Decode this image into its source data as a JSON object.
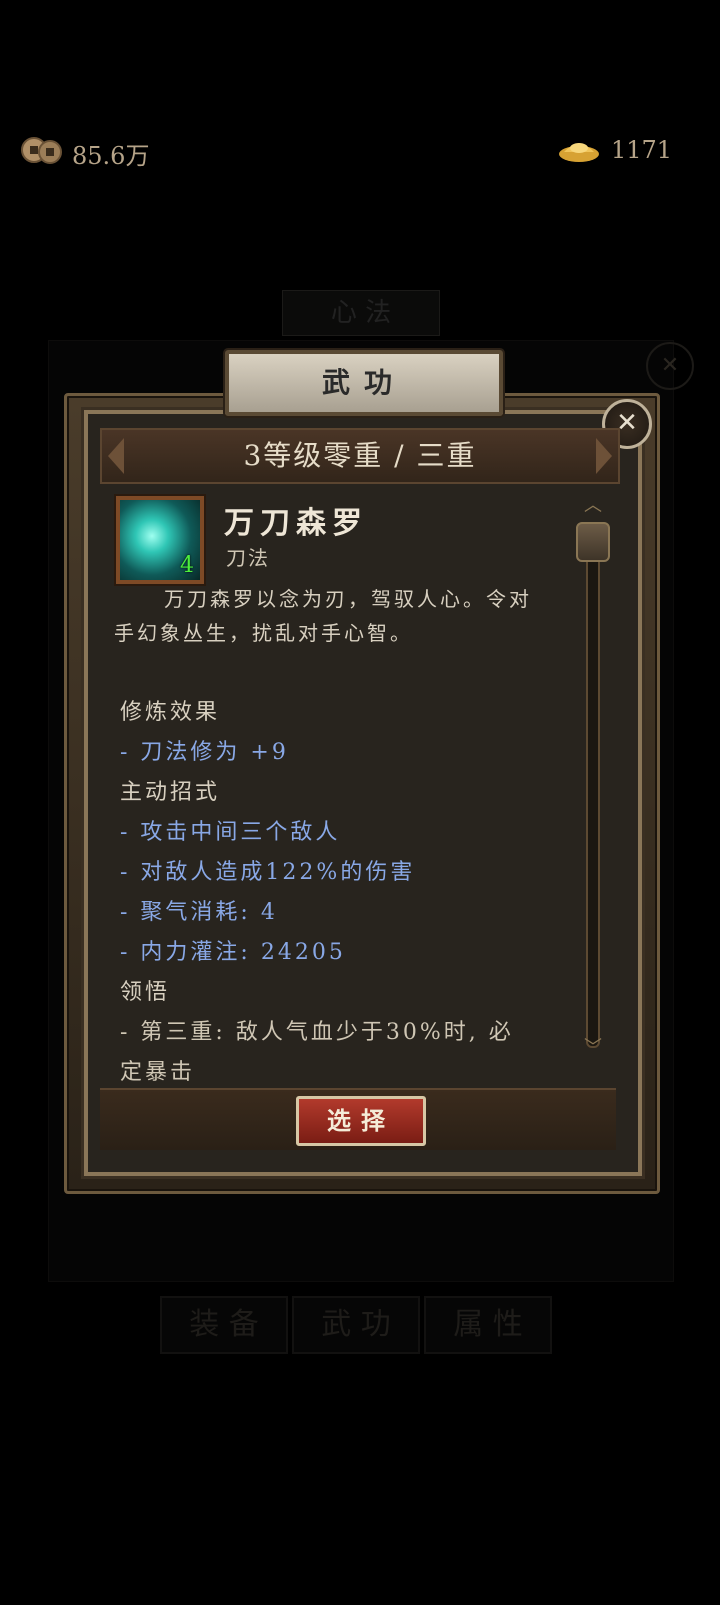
{
  "currency": {
    "coins": "85.6万",
    "ingots": "1171"
  },
  "background": {
    "title": "心 法",
    "close": "✕",
    "tabs": [
      "装 备",
      "武 功",
      "属 性"
    ]
  },
  "modal": {
    "tab_label": "武功",
    "close_icon": "✕",
    "level": "3等级零重 / 三重",
    "skill": {
      "icon_level": "4",
      "name": "万刀森罗",
      "type": "刀法",
      "description": "万刀森罗以念为刃，驾驭人心。令对手幻象丛生，扰乱对手心智。"
    },
    "sections": {
      "cultivation_title": "修炼效果",
      "cultivation_items": [
        "- 刀法修为 +9"
      ],
      "active_title": "主动招式",
      "active_items": [
        "- 攻击中间三个敌人",
        "- 对敌人造成122%的伤害",
        "- 聚气消耗: 4",
        "- 内力灌注: 24205"
      ],
      "insight_title": "领悟",
      "insight_items": [
        "- 第三重: 敌人气血少于30%时, 必",
        "定暴击"
      ]
    },
    "select_button": "选择"
  },
  "colors": {
    "accent_blue": "#89a8e6",
    "button_red": "#9a2a20",
    "frame_gold": "#8a7658"
  }
}
